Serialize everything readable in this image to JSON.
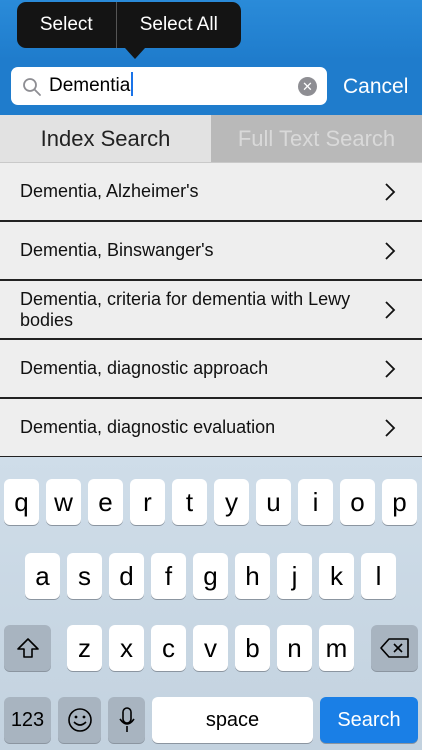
{
  "edit_menu": {
    "select": "Select",
    "select_all": "Select All"
  },
  "search": {
    "value": "Dementia",
    "cancel_label": "Cancel"
  },
  "tabs": [
    {
      "label": "Index Search",
      "active": true
    },
    {
      "label": "Full Text Search",
      "active": false
    }
  ],
  "results": [
    "Dementia, Alzheimer's",
    "Dementia, Binswanger's",
    "Dementia, criteria for dementia with Lewy bodies",
    "Dementia, diagnostic approach",
    "Dementia, diagnostic evaluation"
  ],
  "keyboard": {
    "row1": [
      "q",
      "w",
      "e",
      "r",
      "t",
      "y",
      "u",
      "i",
      "o",
      "p"
    ],
    "row2": [
      "a",
      "s",
      "d",
      "f",
      "g",
      "h",
      "j",
      "k",
      "l"
    ],
    "row3": [
      "z",
      "x",
      "c",
      "v",
      "b",
      "n",
      "m"
    ],
    "numbers_label": "123",
    "space_label": "space",
    "search_label": "Search"
  },
  "colors": {
    "accent": "#1f7ccc",
    "search_key": "#1a7fe6"
  }
}
